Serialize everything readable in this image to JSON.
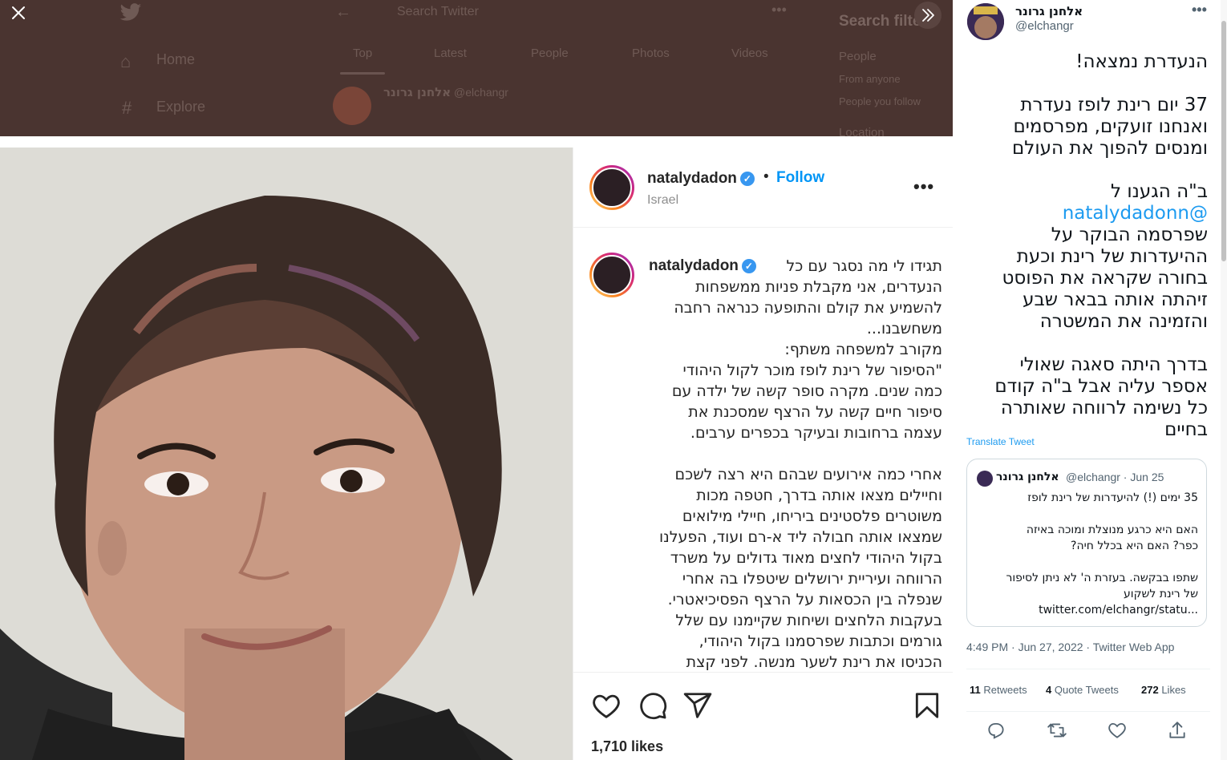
{
  "background_app": {
    "search_placeholder": "Search Twitter",
    "nav_home": "Home",
    "nav_explore": "Explore",
    "tabs": [
      "Top",
      "Latest",
      "People",
      "Photos",
      "Videos"
    ],
    "search_filters_title": "Search filters",
    "filter_people": "People",
    "filter_from_anyone": "From anyone",
    "filter_people_you_follow": "People you follow",
    "filter_location": "Location",
    "result_author": "אלחנן גרונר",
    "result_handle": "@elchangr"
  },
  "viewer": {
    "close_icon": "close-icon",
    "expand_icon": "double-chevron-right-icon"
  },
  "instagram": {
    "username": "natalydadon",
    "dot": "•",
    "follow_label": "Follow",
    "location": "Israel",
    "more_label": "•••",
    "caption_user": "natalydadon",
    "caption_lines": [
      "תגידו לי מה נסגר עם כל",
      "הנעדרים, אני מקבלת פניות ממשפחות",
      "להשמיע את קולם והתופעה כנראה רחבה",
      "משחשבנו...",
      "מקורב למשפחה משתף:",
      "\"הסיפור של רינת לופז מוכר לקול היהודי",
      "כמה שנים. מקרה סופר קשה של ילדה עם",
      "סיפור חיים קשה על הרצף שמסכנת את",
      "עצמה ברחובות ובעיקר בכפרים ערבים.",
      "",
      "אחרי כמה אירועים שבהם היא רצה לשכם",
      "וחיילים מצאו אותה בדרך, חטפה מכות",
      "משוטרים פלסטינים ביריחו, חיילי מילואים",
      "שמצאו אותה חבולה ליד א-רם ועוד, הפעלנו",
      "בקול היהודי לחצים מאוד גדולים על משרד",
      "הרווחה ועיריית ירושלים שיטפלו בה אחרי",
      "שנפלה בין הכסאות על הרצף הפסיכיאטרי.",
      "בעקבות הלחצים ושיחות שקיימנו עם שלל",
      "גורמים וכתבות שפרסמנו בקול היהודי,",
      "הכניסו את רינת לשער מנשה. לפני קצת"
    ],
    "likes": "1,710 likes"
  },
  "tweet": {
    "author_name": "אלחנן גרונר",
    "author_handle": "@elchangr",
    "more_label": "•••",
    "text_blocks": [
      [
        "הנעדרת נמצאה!"
      ],
      [
        "37 יום רינת לופז נעדרת",
        "ואנחנו זועקים, מפרסמים",
        "ומנסים להפוך את העולם"
      ],
      [
        "ב\"ה הגענו ל @natalydadonn",
        "שפרסמה הבוקר על",
        "ההיעדרות של רינת וכעת",
        "בחורה שקראה את הפוסט",
        "זיהתה אותה בבאר שבע",
        "והזמינה את המשטרה"
      ],
      [
        "בדרך היתה סאגה שאולי",
        "אספר עליה אבל ב\"ה קודם",
        "כל נשימה לרווחה שאותרה",
        "בחיים"
      ]
    ],
    "mention": "@natalydadonn",
    "translate_label": "Translate Tweet",
    "quote": {
      "author_name": "אלחנן גרונר",
      "author_handle": "@elchangr · Jun 25",
      "lines": [
        "35 ימים (!) להיעדרות של רינת לופז",
        "",
        "האם היא כרגע מנוצלת ומוכה באיזה",
        "כפר? האם היא בכלל חיה?",
        "",
        "שתפו בבקשה. בעזרת ה' לא ניתן לסיפור",
        "של רינת לשקוע",
        "twitter.com/elchangr/statu..."
      ]
    },
    "timestamp": "4:49 PM · Jun 27, 2022 · Twitter Web App",
    "retweets_count": "11",
    "retweets_label": "Retweets",
    "quotes_count": "4",
    "quotes_label": "Quote Tweets",
    "likes_count": "272",
    "likes_label": "Likes"
  }
}
